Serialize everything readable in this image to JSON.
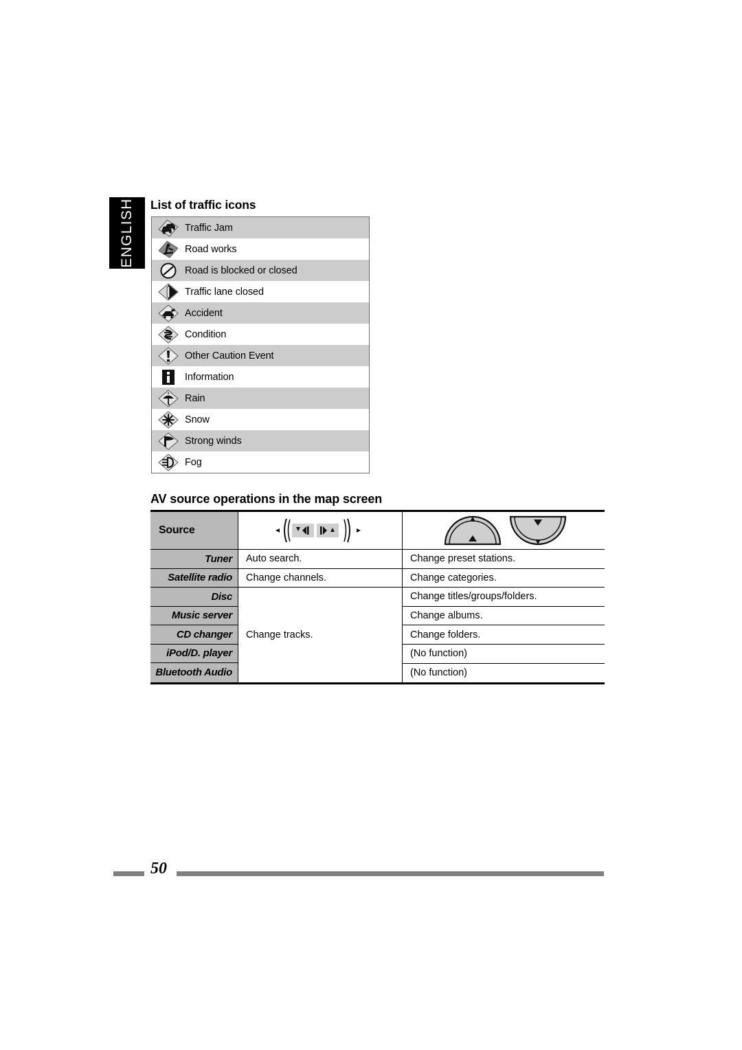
{
  "language_tab": {
    "label": "ENGLISH"
  },
  "sections": {
    "traffic": {
      "heading": "List of traffic icons",
      "rows": [
        {
          "icon": "traffic-jam-icon",
          "label": "Traffic Jam"
        },
        {
          "icon": "road-works-icon",
          "label": "Road works"
        },
        {
          "icon": "road-blocked-icon",
          "label": "Road is blocked or closed"
        },
        {
          "icon": "traffic-lane-closed-icon",
          "label": "Traffic lane closed"
        },
        {
          "icon": "accident-icon",
          "label": "Accident"
        },
        {
          "icon": "condition-icon",
          "label": "Condition"
        },
        {
          "icon": "other-caution-event-icon",
          "label": "Other Caution Event"
        },
        {
          "icon": "information-icon",
          "label": "Information"
        },
        {
          "icon": "rain-icon",
          "label": "Rain"
        },
        {
          "icon": "snow-icon",
          "label": "Snow"
        },
        {
          "icon": "strong-winds-icon",
          "label": "Strong winds"
        },
        {
          "icon": "fog-icon",
          "label": "Fog"
        }
      ]
    },
    "av_source": {
      "heading": "AV source operations in the map screen",
      "header": {
        "source_label": "Source",
        "col2_icon": "track-prev-next-buttons-icon",
        "col3_icon": "up-down-rocker-buttons-icon"
      },
      "rows": [
        {
          "source": "Tuner",
          "col2": "Auto search.",
          "col3": "Change preset stations."
        },
        {
          "source": "Satellite radio",
          "col2": "Change channels.",
          "col3": "Change categories."
        }
      ],
      "grouped": {
        "col2_shared": "Change tracks.",
        "items": [
          {
            "source": "Disc",
            "col3": "Change titles/groups/folders."
          },
          {
            "source": "Music server",
            "col3": "Change albums."
          },
          {
            "source": "CD changer",
            "col3": "Change folders."
          },
          {
            "source": "iPod/D. player",
            "col3": "(No function)"
          },
          {
            "source": "Bluetooth Audio",
            "col3": "(No function)"
          }
        ]
      }
    }
  },
  "footer": {
    "page_number": "50"
  },
  "colors": {
    "shade_row": "#cccccc",
    "source_cell": "#b9b9b9",
    "tab_bg": "#000000",
    "footer_bar": "#808080",
    "table_border": "#6d6d6d"
  }
}
